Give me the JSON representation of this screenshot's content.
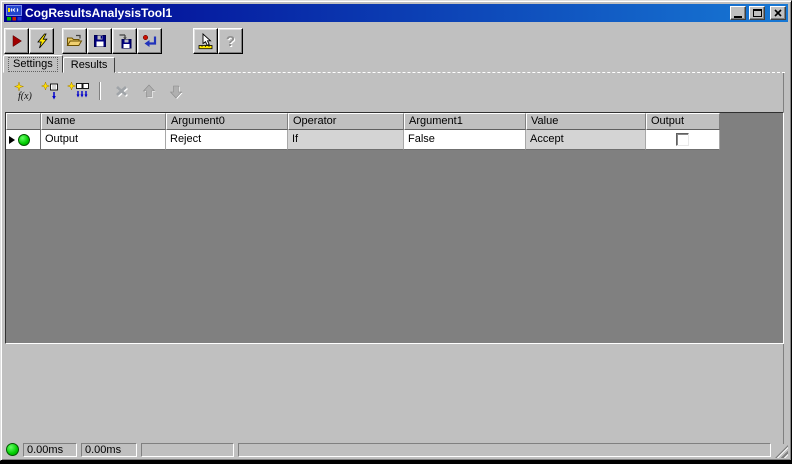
{
  "window": {
    "title": "CogResultsAnalysisTool1"
  },
  "main_toolbar": {
    "buttons": [
      "run",
      "electric-run",
      "open-file",
      "save-file",
      "save-file-as",
      "revert",
      "pointer-tool",
      "help"
    ],
    "help_glyph": "?"
  },
  "tabs": [
    {
      "label": "Settings",
      "active": true
    },
    {
      "label": "Results",
      "active": false
    }
  ],
  "grid_toolbar": {
    "buttons": [
      "add-function",
      "add-input",
      "add-inputs",
      "delete",
      "move-up",
      "move-down"
    ],
    "fx_label": "f(x)"
  },
  "grid": {
    "columns": [
      "Name",
      "Argument0",
      "Operator",
      "Argument1",
      "Value",
      "Output"
    ],
    "row": {
      "status_indicator": "green",
      "name": "Output",
      "argument0": "Reject",
      "operator": "If",
      "argument1": "False",
      "value": "Accept",
      "output_checked": false
    }
  },
  "status_bar": {
    "indicator": "green",
    "panels": [
      "0.00ms",
      "0.00ms",
      "",
      ""
    ]
  },
  "colors": {
    "titlebar_start": "#000090",
    "titlebar_end": "#1778d4",
    "face": "#c0c0c0",
    "grid_background": "#808080",
    "readonly_cell": "#d4d4d4",
    "status_green": "#00cc00",
    "run_red": "#a00000"
  }
}
